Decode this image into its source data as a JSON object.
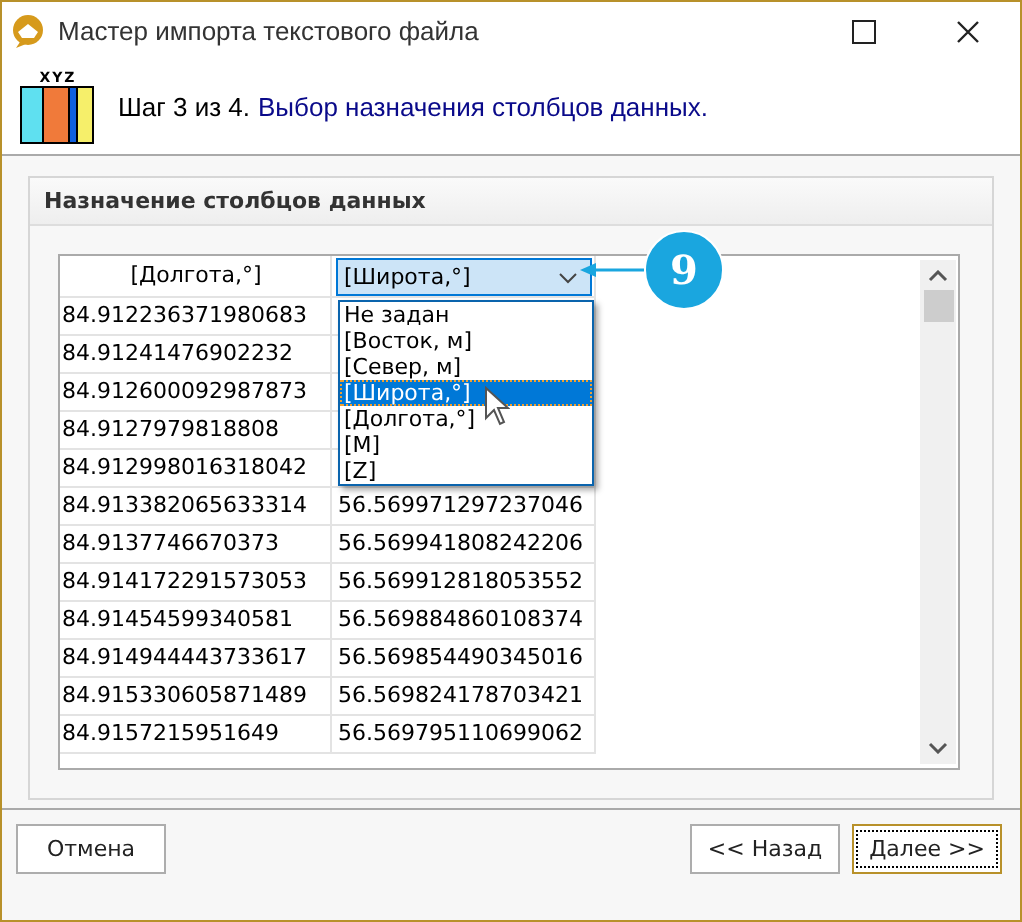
{
  "window": {
    "title": "Мастер импорта текстового файла"
  },
  "header": {
    "icon_label": "XYZ",
    "step": "Шаг 3 из 4.",
    "description": "Выбор назначения столбцов данных."
  },
  "group": {
    "title": "Назначение столбцов данных"
  },
  "grid": {
    "columns": [
      {
        "kind": "label",
        "header": "[Долгота,°]"
      },
      {
        "kind": "combo",
        "value": "[Широта,°]",
        "expanded": true
      }
    ],
    "rows": [
      [
        "84.912236371980683"
      ],
      [
        "84.91241476902232"
      ],
      [
        "84.912600092987873"
      ],
      [
        "84.9127979818808"
      ],
      [
        "84.912998016318042"
      ],
      [
        "84.913382065633314",
        "56.569971297237046"
      ],
      [
        "84.9137746670373",
        "56.569941808242206"
      ],
      [
        "84.914172291573053",
        "56.569912818053552"
      ],
      [
        "84.91454599340581",
        "56.569884860108374"
      ],
      [
        "84.914944443733617",
        "56.569854490345016"
      ],
      [
        "84.915330605871489",
        "56.569824178703421"
      ],
      [
        "84.9157215951649",
        "56.569795110699062"
      ]
    ]
  },
  "dropdown_list": {
    "options": [
      {
        "label": "Не задан",
        "selected": false
      },
      {
        "label": "[Восток, м]",
        "selected": false
      },
      {
        "label": "[Север, м]",
        "selected": false
      },
      {
        "label": "[Широта,°]",
        "selected": true
      },
      {
        "label": "[Долгота,°]",
        "selected": false
      },
      {
        "label": "[M]",
        "selected": false
      },
      {
        "label": "[Z]",
        "selected": false
      }
    ]
  },
  "callout": {
    "number": "9"
  },
  "buttons": [
    {
      "label": "Отмена",
      "default": false
    },
    {
      "label": "<< Назад",
      "default": false
    },
    {
      "label": "Далее >>",
      "default": true
    }
  ]
}
